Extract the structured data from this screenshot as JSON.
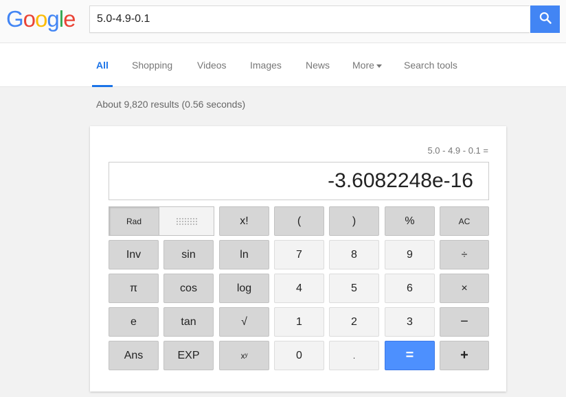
{
  "logo": {
    "letters": [
      {
        "ch": "G",
        "color": "#4285f4"
      },
      {
        "ch": "o",
        "color": "#ea4335"
      },
      {
        "ch": "o",
        "color": "#fbbc05"
      },
      {
        "ch": "g",
        "color": "#4285f4"
      },
      {
        "ch": "l",
        "color": "#34a853"
      },
      {
        "ch": "e",
        "color": "#ea4335"
      }
    ]
  },
  "search": {
    "value": "5.0-4.9-0.1",
    "icon": "search-icon",
    "button_color": "#4285f4"
  },
  "tabs": [
    {
      "label": "All",
      "active": true
    },
    {
      "label": "Shopping"
    },
    {
      "label": "Videos"
    },
    {
      "label": "Images"
    },
    {
      "label": "News"
    },
    {
      "label": "More",
      "dropdown": true
    },
    {
      "label": "Search tools"
    }
  ],
  "stats": "About 9,820 results (0.56 seconds)",
  "calculator": {
    "expression": "5.0 - 4.9 - 0.1 =",
    "result": "-3.6082248e-16",
    "mode": {
      "rad": "Rad"
    },
    "keys": {
      "fact": "x!",
      "lparen": "(",
      "rparen": ")",
      "percent": "%",
      "ac": "AC",
      "inv": "Inv",
      "sin": "sin",
      "ln": "ln",
      "seven": "7",
      "eight": "8",
      "nine": "9",
      "divide": "÷",
      "pi": "π",
      "cos": "cos",
      "log": "log",
      "four": "4",
      "five": "5",
      "six": "6",
      "multiply": "×",
      "e": "e",
      "tan": "tan",
      "sqrt": "√",
      "one": "1",
      "two": "2",
      "three": "3",
      "minus": "−",
      "ans": "Ans",
      "exp": "EXP",
      "pow": "xʸ",
      "zero": "0",
      "dot": ".",
      "equals": "=",
      "plus": "+"
    },
    "equals_color": "#4d90fe"
  }
}
